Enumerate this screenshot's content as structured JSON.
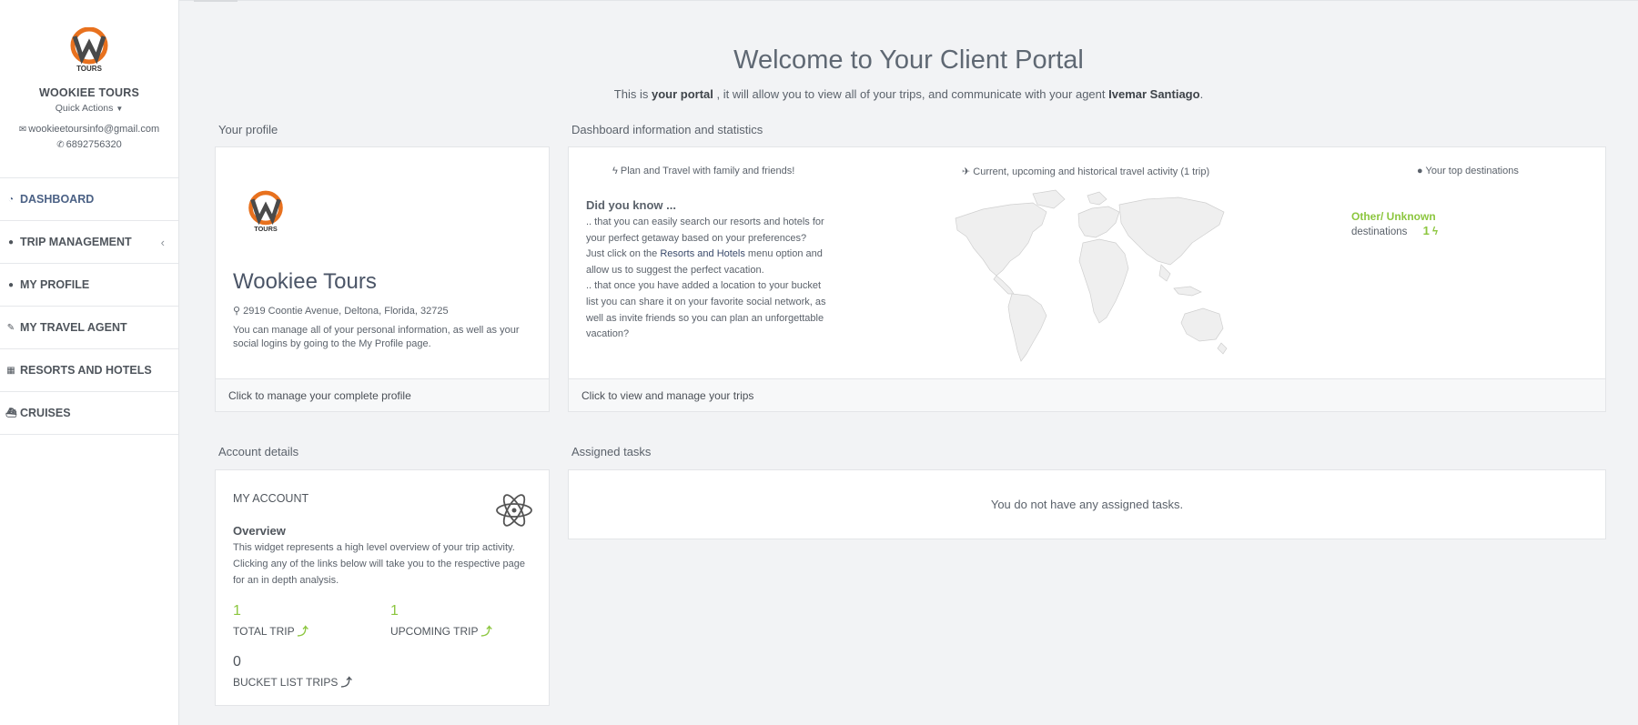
{
  "sidebar": {
    "brand_name": "WOOKIEE TOURS",
    "quick_actions": "Quick Actions",
    "email": "wookieetoursinfo@gmail.com",
    "phone": "6892756320",
    "logo_text": "TOURS",
    "items": [
      {
        "label": "DASHBOARD",
        "icon": "dashboard-icon"
      },
      {
        "label": "TRIP MANAGEMENT",
        "icon": "globe-icon"
      },
      {
        "label": "MY PROFILE",
        "icon": "user-icon"
      },
      {
        "label": "MY TRAVEL AGENT",
        "icon": "agent-icon"
      },
      {
        "label": "RESORTS AND HOTELS",
        "icon": "building-icon"
      },
      {
        "label": "CRUISES",
        "icon": "ship-icon"
      }
    ]
  },
  "header": {
    "title": "Welcome to Your Client Portal",
    "sub_pre": "This is ",
    "sub_bold": "your portal",
    "sub_mid": " , it will allow you to view all of your trips, and communicate with your agent ",
    "agent": "Ivemar Santiago",
    "sub_end": "."
  },
  "profile": {
    "section_title": "Your profile",
    "name": "Wookiee Tours",
    "address": "2919 Coontie Avenue, Deltona, Florida, 32725",
    "description": "You can manage all of your personal information, as well as your social logins by going to the My Profile page.",
    "footer": "Click to manage your complete profile"
  },
  "dashboard": {
    "section_title": "Dashboard information and statistics",
    "col1_title": "Plan and Travel with family and friends!",
    "col2_title": "Current, upcoming and historical travel activity (1 trip)",
    "col3_title": "Your top destinations",
    "did_you_know": "Did you know ...",
    "tip1": ".. that you can easily search our resorts and hotels for your perfect getaway based on your preferences? Just click on the ",
    "tip1_link": "Resorts and Hotels",
    "tip1_end": " menu option and allow us to suggest the perfect vacation.",
    "tip2": ".. that once you have added a location to your bucket list you can share it on your favorite social network, as well as invite friends so you can plan an unforgettable vacation?",
    "destination_name": "Other/ Unknown",
    "destination_label": "destinations",
    "destination_count": "1",
    "footer": "Click to view and manage your trips"
  },
  "account": {
    "section_title": "Account details",
    "title": "MY ACCOUNT",
    "overview_title": "Overview",
    "overview_text": "This widget represents a high level overview of your trip activity. Clicking any of the links below will take you to the respective page for an in depth analysis.",
    "total_trip_count": "1",
    "total_trip_label": "TOTAL TRIP",
    "upcoming_trip_count": "1",
    "upcoming_trip_label": "UPCOMING TRIP",
    "bucket_count": "0",
    "bucket_label": "BUCKET LIST TRIPS"
  },
  "tasks": {
    "section_title": "Assigned tasks",
    "empty_text": "You do not have any assigned tasks."
  },
  "colors": {
    "accent_green": "#8cc63f",
    "nav_active": "#4b6185",
    "logo_orange": "#e8711e"
  }
}
